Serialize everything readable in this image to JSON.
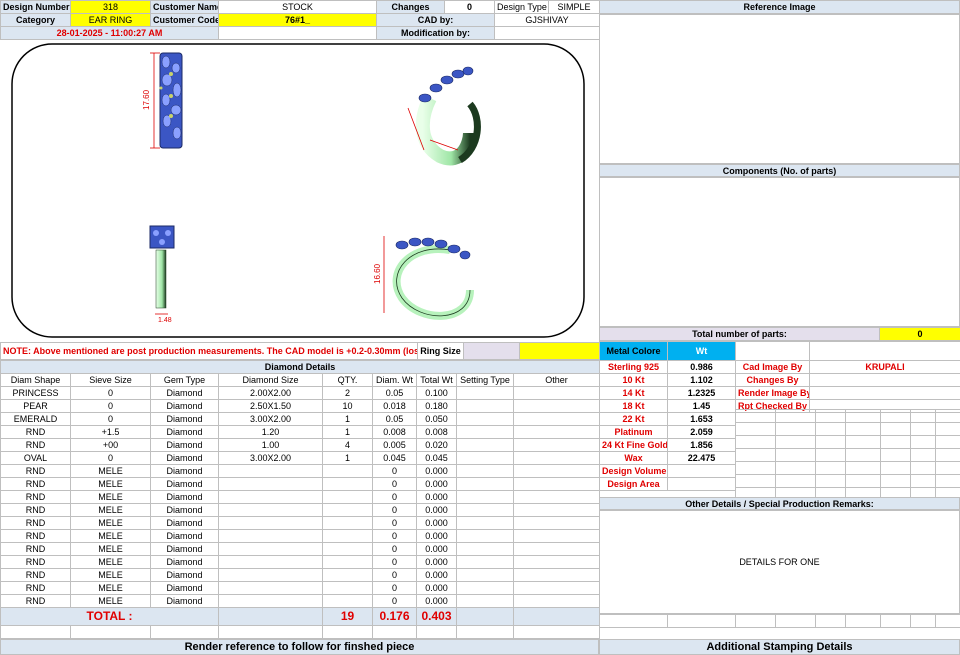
{
  "header": {
    "design_number_label": "Design Number",
    "design_number": "318",
    "customer_name_label": "Customer Name",
    "customer_name": "STOCK",
    "changes_label": "Changes",
    "changes": "0",
    "design_type_label": "Design Type",
    "design_type": "SIMPLE",
    "category_label": "Category",
    "category": "EAR RING",
    "customer_code_label": "Customer Code",
    "customer_code": "76#1_",
    "cad_by_label": "CAD by:",
    "cad_by": "GJSHIVAY",
    "timestamp": "28-01-2025 - 11:00:27 AM",
    "modification_label": "Modification by:"
  },
  "cad_views": {
    "dim_height": "17.60",
    "dim_width": "1.48",
    "dim_diameter": "16.60"
  },
  "note": "NOTE: Above mentioned are post production measurements. The CAD model is +0.2-0.30mm (loss)",
  "ring_size_label": "Ring Size",
  "diamond": {
    "title": "Diamond Details",
    "columns": [
      "Diam Shape",
      "Sieve Size",
      "Gem Type",
      "Diamond Size",
      "QTY.",
      "Diam. Wt",
      "Total Wt",
      "Setting Type",
      "Other"
    ],
    "rows": [
      [
        "PRINCESS",
        "0",
        "Diamond",
        "2.00X2.00",
        "2",
        "0.05",
        "0.100",
        "",
        ""
      ],
      [
        "PEAR",
        "0",
        "Diamond",
        "2.50X1.50",
        "10",
        "0.018",
        "0.180",
        "",
        ""
      ],
      [
        "EMERALD",
        "0",
        "Diamond",
        "3.00X2.00",
        "1",
        "0.05",
        "0.050",
        "",
        ""
      ],
      [
        "RND",
        "+1.5",
        "Diamond",
        "1.20",
        "1",
        "0.008",
        "0.008",
        "",
        ""
      ],
      [
        "RND",
        "+00",
        "Diamond",
        "1.00",
        "4",
        "0.005",
        "0.020",
        "",
        ""
      ],
      [
        "OVAL",
        "0",
        "Diamond",
        "3.00X2.00",
        "1",
        "0.045",
        "0.045",
        "",
        ""
      ],
      [
        "RND",
        "MELE",
        "Diamond",
        "",
        "",
        "0",
        "0.000",
        "",
        ""
      ],
      [
        "RND",
        "MELE",
        "Diamond",
        "",
        "",
        "0",
        "0.000",
        "",
        ""
      ],
      [
        "RND",
        "MELE",
        "Diamond",
        "",
        "",
        "0",
        "0.000",
        "",
        ""
      ],
      [
        "RND",
        "MELE",
        "Diamond",
        "",
        "",
        "0",
        "0.000",
        "",
        ""
      ],
      [
        "RND",
        "MELE",
        "Diamond",
        "",
        "",
        "0",
        "0.000",
        "",
        ""
      ],
      [
        "RND",
        "MELE",
        "Diamond",
        "",
        "",
        "0",
        "0.000",
        "",
        ""
      ],
      [
        "RND",
        "MELE",
        "Diamond",
        "",
        "",
        "0",
        "0.000",
        "",
        ""
      ],
      [
        "RND",
        "MELE",
        "Diamond",
        "",
        "",
        "0",
        "0.000",
        "",
        ""
      ],
      [
        "RND",
        "MELE",
        "Diamond",
        "",
        "",
        "0",
        "0.000",
        "",
        ""
      ],
      [
        "RND",
        "MELE",
        "Diamond",
        "",
        "",
        "0",
        "0.000",
        "",
        ""
      ],
      [
        "RND",
        "MELE",
        "Diamond",
        "",
        "",
        "0",
        "0.000",
        "",
        ""
      ]
    ],
    "total_label": "TOTAL :",
    "total_qty": "19",
    "total_diam_wt": "0.176",
    "total_wt": "0.403"
  },
  "render_reference": "Render reference to follow for finshed piece",
  "reference_image_title": "Reference Image",
  "components_title": "Components (No. of parts)",
  "total_parts_label": "Total number of parts:",
  "total_parts": "0",
  "metal": {
    "color_label": "Metal Colore",
    "wt_label": "Wt",
    "rows": [
      [
        "Sterling 925",
        "0.986"
      ],
      [
        "10 Kt",
        "1.102"
      ],
      [
        "14 Kt",
        "1.2325"
      ],
      [
        "18 Kt",
        "1.45"
      ],
      [
        "22 Kt",
        "1.653"
      ],
      [
        "Platinum",
        "2.059"
      ],
      [
        "24 Kt Fine Gold",
        "1.856"
      ],
      [
        "Wax",
        "22.475"
      ],
      [
        "Design Volume",
        ""
      ],
      [
        "Design Area",
        ""
      ]
    ]
  },
  "credits": {
    "rows": [
      [
        "Cad Image By",
        "KRUPALI"
      ],
      [
        "Changes By",
        ""
      ],
      [
        "Render Image By",
        ""
      ],
      [
        "Rpt Checked By",
        ""
      ]
    ]
  },
  "other_details_title": "Other Details / Special Production Remarks:",
  "other_details_text": "DETAILS FOR ONE",
  "stamping_title": "Additional Stamping Details",
  "colors": {
    "header_blue": "#dce6f1",
    "yellow": "#ffff00",
    "metal_blue": "#00b0f0",
    "red_text": "#e00000",
    "lavender": "#e4dfec"
  }
}
